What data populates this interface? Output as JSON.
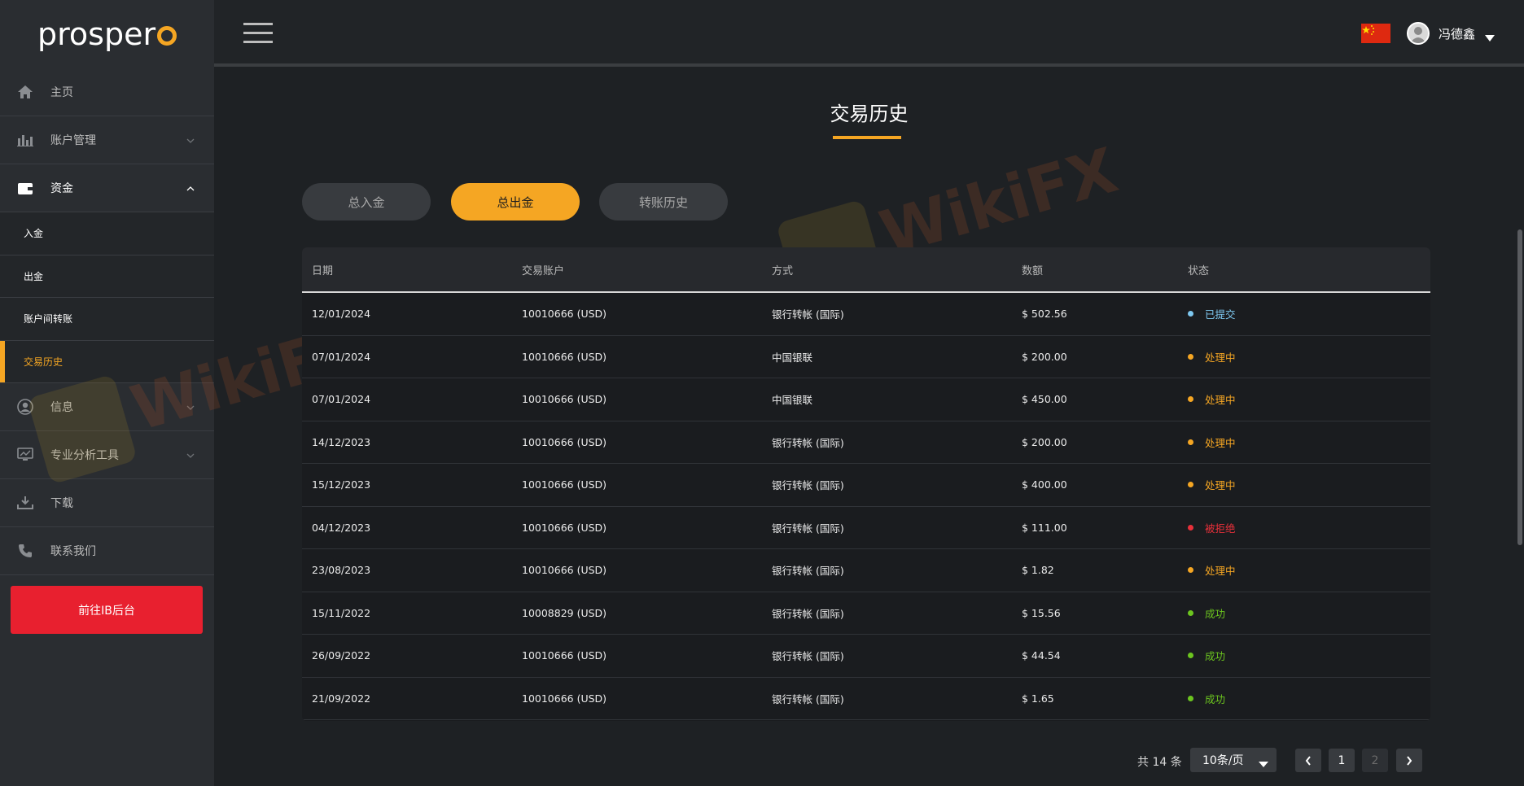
{
  "app": {
    "logo": "prosper",
    "logo_ring_color": "#f5a623"
  },
  "sidebar": {
    "items": [
      {
        "label": "主页",
        "icon": "home-icon"
      },
      {
        "label": "账户管理",
        "icon": "bar-chart-icon"
      },
      {
        "label": "资金",
        "icon": "wallet-icon"
      },
      {
        "label": "信息",
        "icon": "user-circle-icon"
      },
      {
        "label": "专业分析工具",
        "icon": "monitor-icon"
      },
      {
        "label": "下载",
        "icon": "download-icon"
      },
      {
        "label": "联系我们",
        "icon": "phone-icon"
      }
    ],
    "sub_items": [
      {
        "label": "入金"
      },
      {
        "label": "出金"
      },
      {
        "label": "账户间转账"
      },
      {
        "label": "交易历史"
      }
    ],
    "ib_button": "前往IB后台"
  },
  "header": {
    "username": "冯德鑫",
    "flag": "china-flag-icon"
  },
  "main": {
    "title": "交易历史",
    "tabs": [
      {
        "label": "总入金",
        "active": false
      },
      {
        "label": "总出金",
        "active": true
      },
      {
        "label": "转账历史",
        "active": false
      }
    ],
    "table": {
      "columns": [
        "日期",
        "交易账户",
        "方式",
        "数额",
        "状态"
      ],
      "rows": [
        {
          "date": "12/01/2024",
          "account": "10010666 (USD)",
          "method": "银行转帐 (国际)",
          "amount": "$ 502.56",
          "status": "已提交",
          "status_color": "#7ec8f0"
        },
        {
          "date": "07/01/2024",
          "account": "10010666 (USD)",
          "method": "中国银联",
          "amount": "$ 200.00",
          "status": "处理中",
          "status_color": "#f5a623"
        },
        {
          "date": "07/01/2024",
          "account": "10010666 (USD)",
          "method": "中国银联",
          "amount": "$ 450.00",
          "status": "处理中",
          "status_color": "#f5a623"
        },
        {
          "date": "14/12/2023",
          "account": "10010666 (USD)",
          "method": "银行转帐 (国际)",
          "amount": "$ 200.00",
          "status": "处理中",
          "status_color": "#f5a623"
        },
        {
          "date": "15/12/2023",
          "account": "10010666 (USD)",
          "method": "银行转帐 (国际)",
          "amount": "$ 400.00",
          "status": "处理中",
          "status_color": "#f5a623"
        },
        {
          "date": "04/12/2023",
          "account": "10010666 (USD)",
          "method": "银行转帐 (国际)",
          "amount": "$ 111.00",
          "status": "被拒绝",
          "status_color": "#e8303a"
        },
        {
          "date": "23/08/2023",
          "account": "10010666 (USD)",
          "method": "银行转帐 (国际)",
          "amount": "$ 1.82",
          "status": "处理中",
          "status_color": "#f5a623"
        },
        {
          "date": "15/11/2022",
          "account": "10008829 (USD)",
          "method": "银行转帐 (国际)",
          "amount": "$ 15.56",
          "status": "成功",
          "status_color": "#6cc51f"
        },
        {
          "date": "26/09/2022",
          "account": "10010666 (USD)",
          "method": "银行转帐 (国际)",
          "amount": "$ 44.54",
          "status": "成功",
          "status_color": "#6cc51f"
        },
        {
          "date": "21/09/2022",
          "account": "10010666 (USD)",
          "method": "银行转帐 (国际)",
          "amount": "$ 1.65",
          "status": "成功",
          "status_color": "#6cc51f"
        }
      ]
    },
    "pagination": {
      "total": "共 14 条",
      "page_size": "10条/页",
      "pages": [
        "1",
        "2"
      ],
      "current_page": "1"
    }
  },
  "watermark": "WikiFX",
  "colors": {
    "accent": "#f5a623",
    "danger_button": "#e8202f",
    "background": "#1e2124"
  }
}
